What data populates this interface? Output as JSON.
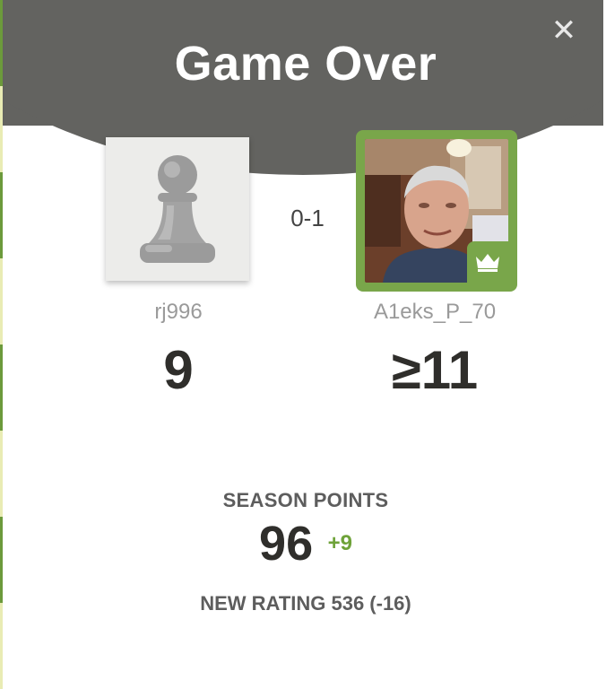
{
  "modal": {
    "title": "Game Over",
    "close_icon": "close-icon"
  },
  "result": {
    "score": "0-1"
  },
  "players": {
    "left": {
      "username": "rj996",
      "rating": "9",
      "avatar_icon": "pawn-icon"
    },
    "right": {
      "username": "A1eks_P_70",
      "rating": "≥11",
      "winner_badge_icon": "crown-icon",
      "accent_color": "#79a64a"
    }
  },
  "season": {
    "label": "SEASON POINTS",
    "value": "96",
    "delta": "+9",
    "delta_color": "#6ea239"
  },
  "new_rating": {
    "text": "NEW RATING 536 (-16)"
  },
  "colors": {
    "header": "#636360",
    "text_dark": "#2f2e2b",
    "text_muted": "#9a9a9a"
  }
}
